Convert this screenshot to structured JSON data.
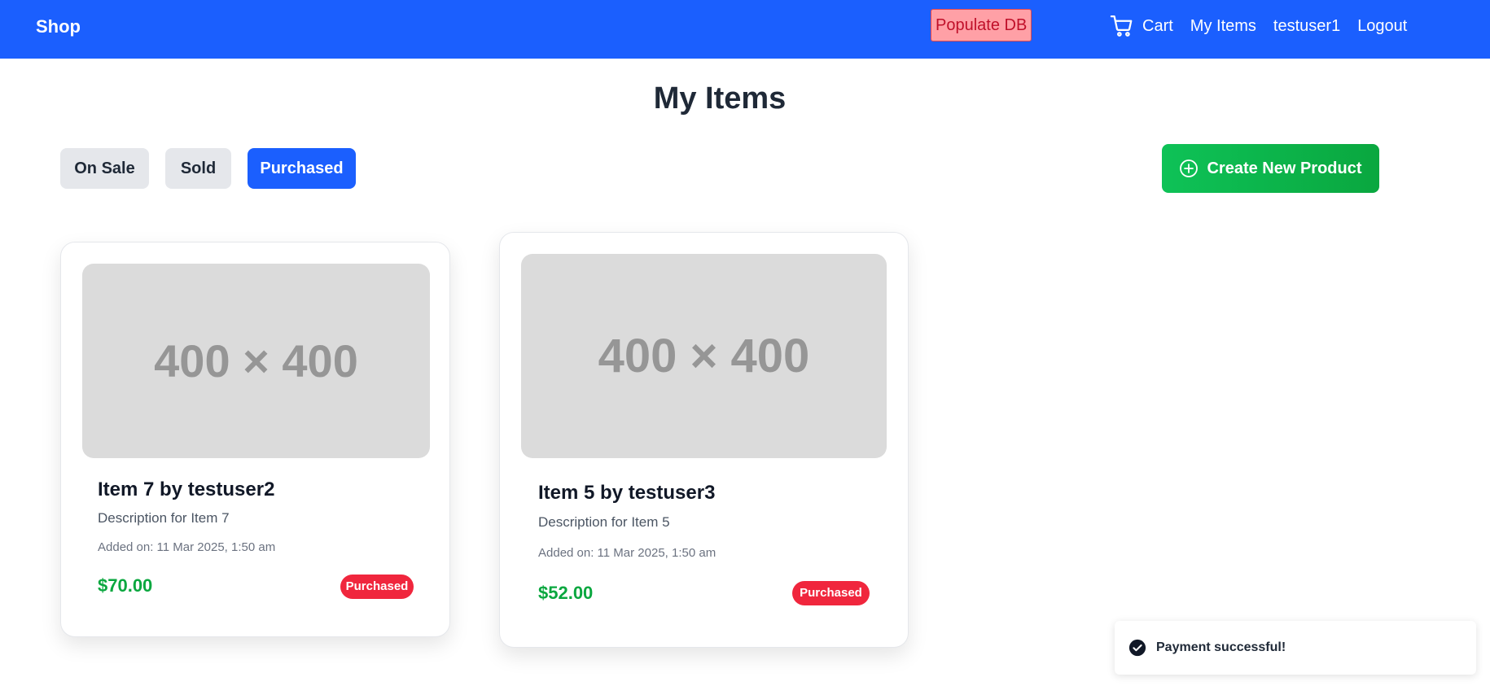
{
  "navbar": {
    "brand": "Shop",
    "populate_label": "Populate DB",
    "cart_label": "Cart",
    "my_items_label": "My Items",
    "username": "testuser1",
    "logout_label": "Logout",
    "cart_icon": "cart-icon"
  },
  "page": {
    "title": "My Items"
  },
  "filters": {
    "tabs": [
      {
        "label": "On Sale",
        "active": false
      },
      {
        "label": "Sold",
        "active": false
      },
      {
        "label": "Purchased",
        "active": true
      }
    ]
  },
  "actions": {
    "create_label": "Create New Product",
    "create_icon": "plus-circle-icon"
  },
  "items": [
    {
      "image_text": "400 × 400",
      "title": "Item 7 by testuser2",
      "description": "Description for Item 7",
      "added": "Added on: 11 Mar 2025, 1:50 am",
      "price": "$70.00",
      "status": "Purchased"
    },
    {
      "image_text": "400 × 400",
      "title": "Item 5 by testuser3",
      "description": "Description for Item 5",
      "added": "Added on: 11 Mar 2025, 1:50 am",
      "price": "$52.00",
      "status": "Purchased"
    }
  ],
  "toast": {
    "message": "Payment successful!",
    "icon": "check-circle-icon"
  },
  "colors": {
    "primary": "#1b5ffe",
    "success": "#0aa73f",
    "danger": "#f0263d",
    "populate_bg": "#ffa0a6"
  }
}
